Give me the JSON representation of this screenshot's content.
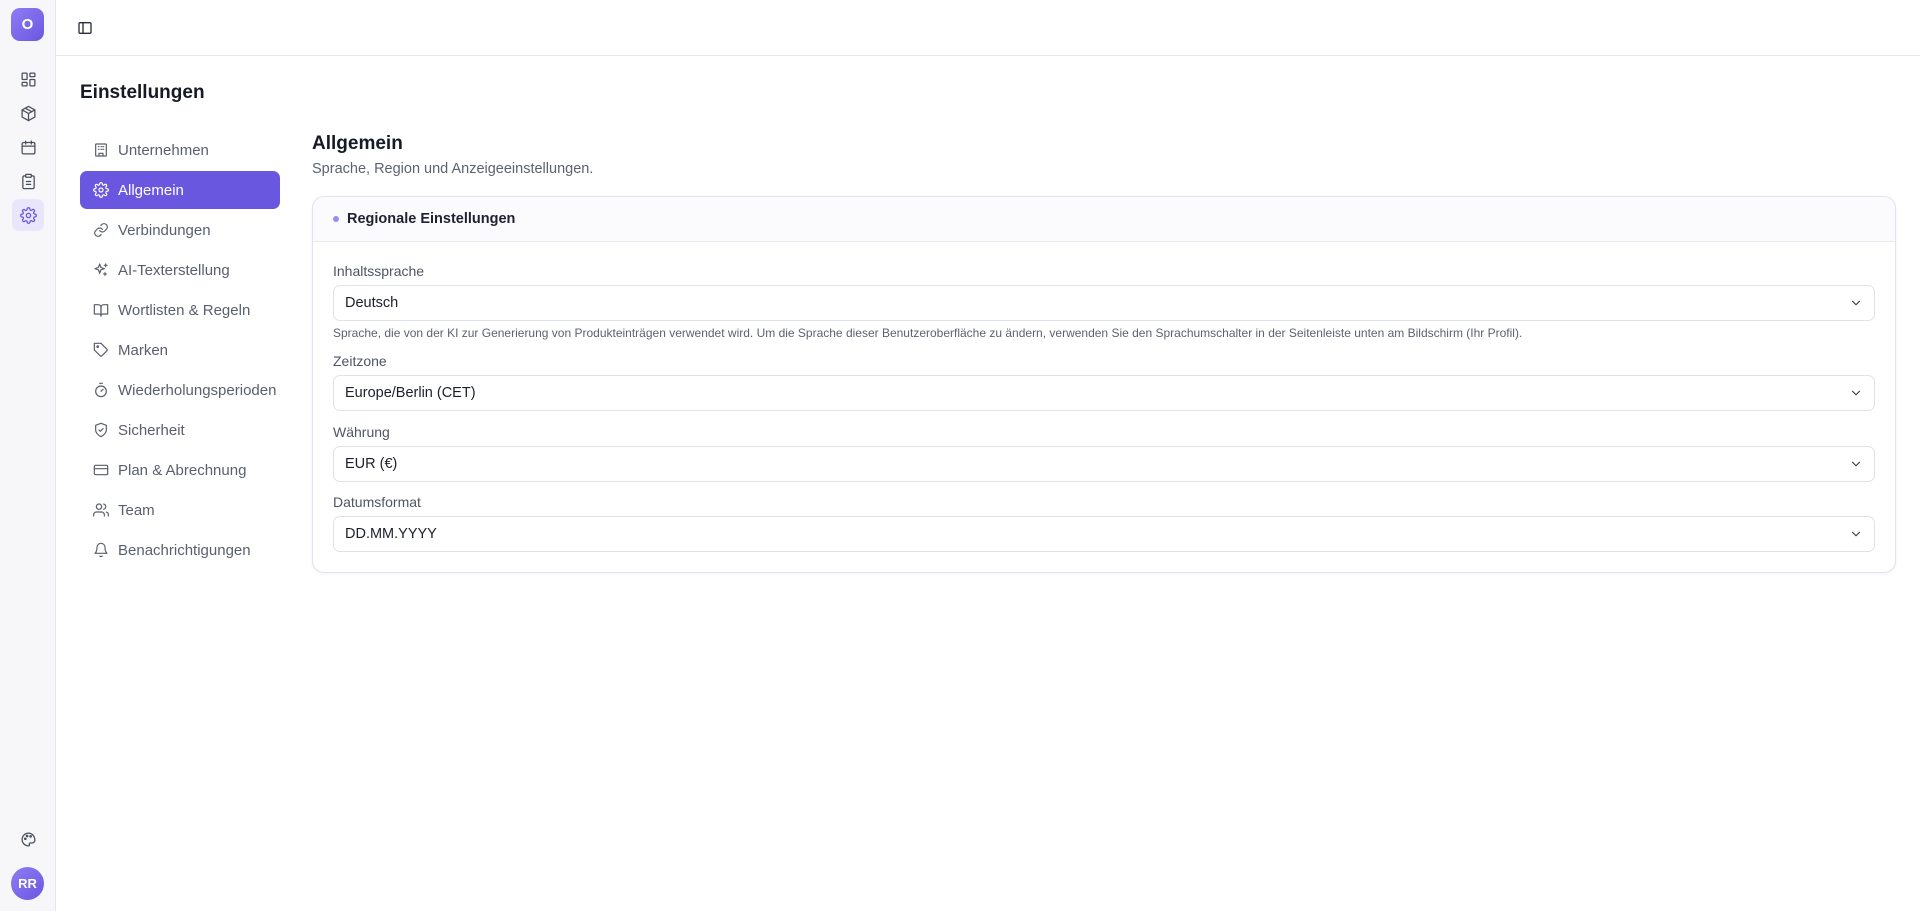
{
  "rail": {
    "logo_letter": "O",
    "items": [
      {
        "icon": "dashboard-icon"
      },
      {
        "icon": "package-icon"
      },
      {
        "icon": "calendar-icon"
      },
      {
        "icon": "clipboard-icon"
      },
      {
        "icon": "settings-icon",
        "active": true
      }
    ],
    "bottom_icon": "palette-icon",
    "avatar_initials": "RR"
  },
  "header": {
    "toggle_icon": "sidebar-toggle-icon"
  },
  "page": {
    "title": "Einstellungen"
  },
  "nav": {
    "items": [
      {
        "label": "Unternehmen",
        "icon": "building-icon"
      },
      {
        "label": "Allgemein",
        "icon": "gear-icon",
        "active": true
      },
      {
        "label": "Verbindungen",
        "icon": "link-icon"
      },
      {
        "label": "AI-Texterstellung",
        "icon": "sparkles-icon"
      },
      {
        "label": "Wortlisten & Regeln",
        "icon": "book-icon"
      },
      {
        "label": "Marken",
        "icon": "tag-icon"
      },
      {
        "label": "Wiederholungsperioden",
        "icon": "timer-icon"
      },
      {
        "label": "Sicherheit",
        "icon": "shield-icon"
      },
      {
        "label": "Plan & Abrechnung",
        "icon": "credit-card-icon"
      },
      {
        "label": "Team",
        "icon": "users-icon"
      },
      {
        "label": "Benachrichtigungen",
        "icon": "bell-icon"
      }
    ]
  },
  "main": {
    "title": "Allgemein",
    "subtitle": "Sprache, Region und Anzeigeeinstellungen.",
    "card": {
      "title": "Regionale Einstellungen",
      "fields": {
        "content_language": {
          "label": "Inhaltssprache",
          "value": "Deutsch",
          "help": "Sprache, die von der KI zur Generierung von Produkteinträgen verwendet wird. Um die Sprache dieser Benutzeroberfläche zu ändern, verwenden Sie den Sprachumschalter in der Seitenleiste unten am Bildschirm (Ihr Profil)."
        },
        "timezone": {
          "label": "Zeitzone",
          "value": "Europe/Berlin (CET)"
        },
        "currency": {
          "label": "Währung",
          "value": "EUR (€)"
        },
        "date_format": {
          "label": "Datumsformat",
          "value": "DD.MM.YYYY"
        }
      }
    }
  },
  "colors": {
    "accent": "#6a57e0",
    "rail_bg": "#f7f7f9"
  }
}
